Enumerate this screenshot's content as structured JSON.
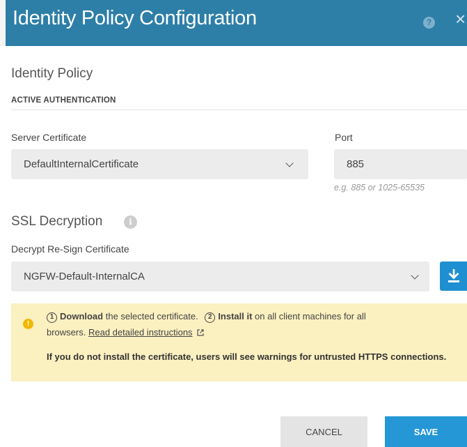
{
  "dialog": {
    "title": "Identity Policy Configuration",
    "help_glyph": "?",
    "close_glyph": "×"
  },
  "identity_policy": {
    "heading": "Identity Policy",
    "subheading": "ACTIVE AUTHENTICATION",
    "server_certificate": {
      "label": "Server Certificate",
      "value": "DefaultInternalCertificate"
    },
    "port": {
      "label": "Port",
      "value": "885",
      "hint": "e.g. 885 or 1025-65535"
    }
  },
  "ssl_decryption": {
    "heading": "SSL Decryption",
    "resign_certificate": {
      "label": "Decrypt Re-Sign Certificate",
      "value": "NGFW-Default-InternalCA"
    }
  },
  "alert": {
    "step1_num": "1",
    "step1_bold": "Download",
    "step1_text": " the selected certificate.",
    "step2_num": "2",
    "step2_bold": "Install it",
    "step2_text": " on all client machines for all",
    "line2_text": "browsers. ",
    "link_text": "Read detailed instructions",
    "warning": "If you do not install the certificate, users will see warnings for untrusted HTTPS connections."
  },
  "footer": {
    "cancel_label": "CANCEL",
    "save_label": "SAVE"
  },
  "colors": {
    "header": "#2d7fa8",
    "primary": "#2597d6",
    "alert_bg": "#fbf0c0",
    "warning": "#f2b807"
  }
}
